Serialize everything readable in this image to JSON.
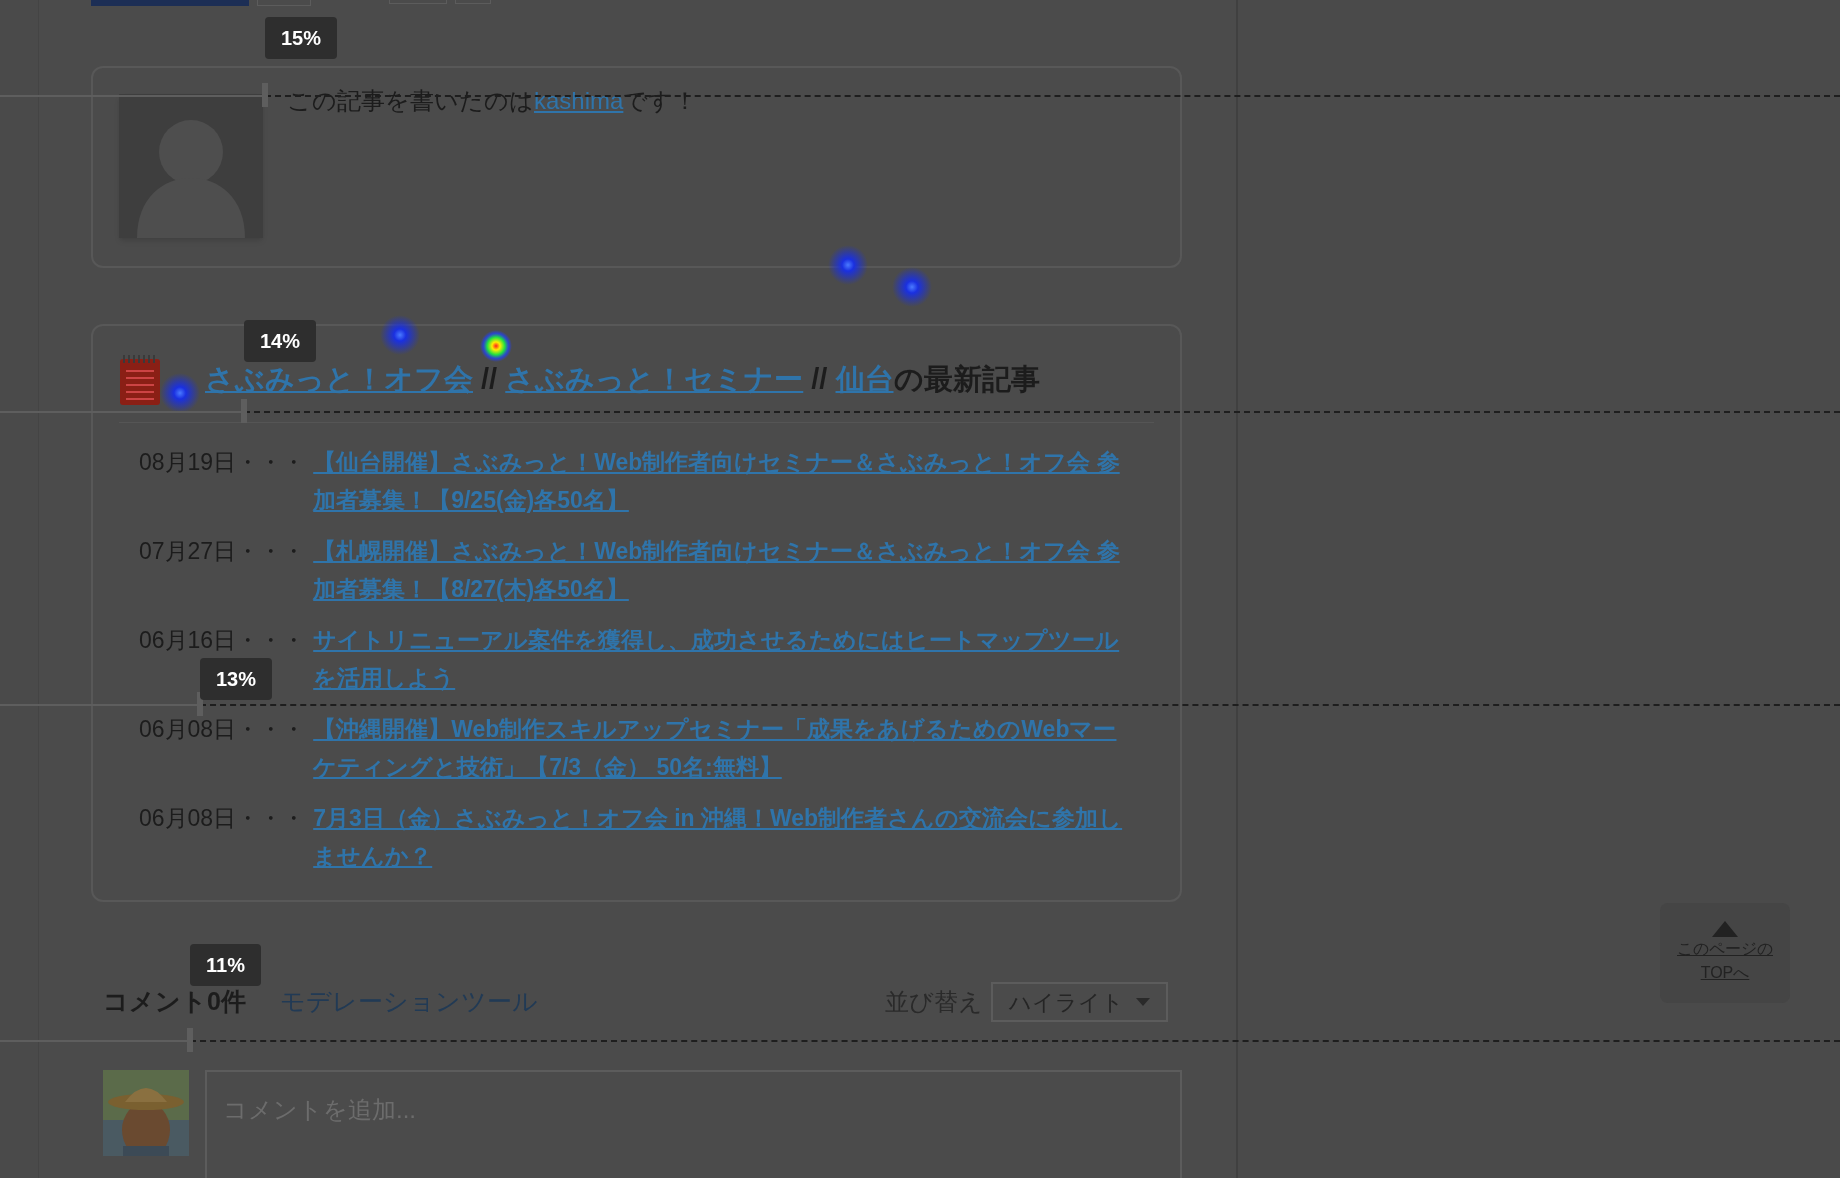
{
  "author_box": {
    "text_before": "この記事を書いたのは",
    "author_link": "kashima",
    "text_after": "です！"
  },
  "recent_posts": {
    "title_links": [
      "さぶみっと！オフ会",
      "さぶみっと！セミナー",
      "仙台"
    ],
    "separator": "//",
    "title_suffix": "の最新記事",
    "items": [
      {
        "date": "08月19日・・・",
        "title": "【仙台開催】さぶみっと！Web制作者向けセミナー＆さぶみっと！オフ会 参加者募集！【9/25(金)各50名】"
      },
      {
        "date": "07月27日・・・",
        "title": "【札幌開催】さぶみっと！Web制作者向けセミナー＆さぶみっと！オフ会 参加者募集！【8/27(木)各50名】"
      },
      {
        "date": "06月16日・・・",
        "title": "サイトリニューアル案件を獲得し、成功させるためにはヒートマップツールを活用しよう"
      },
      {
        "date": "06月08日・・・",
        "title": "【沖縄開催】Web制作スキルアップセミナー「成果をあげるためのWebマーケティングと技術」【7/3（金） 50名:無料】"
      },
      {
        "date": "06月08日・・・",
        "title": "7月3日（金）さぶみっと！オフ会 in 沖縄！Web制作者さんの交流会に参加しませんか？"
      }
    ]
  },
  "comments": {
    "count_label": "コメント0件",
    "moderation_link": "モデレーションツール",
    "sort_label": "並び替え",
    "sort_value": "ハイライト",
    "input_placeholder": "コメントを追加..."
  },
  "page_top_button": {
    "line1": "このページの",
    "line2": "TOPへ"
  },
  "scroll_markers": [
    {
      "label": "15%"
    },
    {
      "label": "14%"
    },
    {
      "label": "13%"
    },
    {
      "label": "11%"
    }
  ]
}
